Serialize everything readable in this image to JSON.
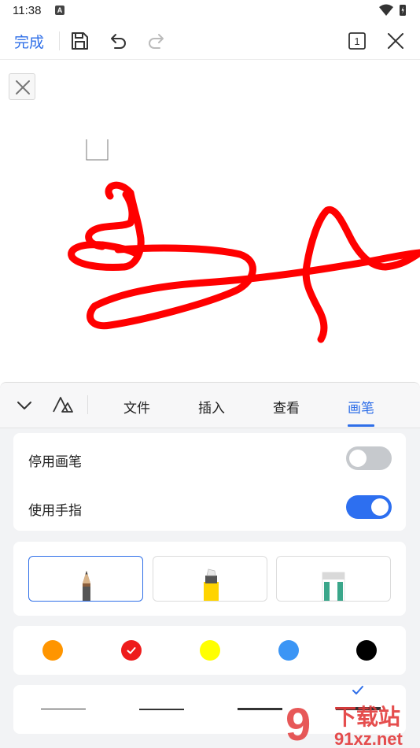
{
  "status_bar": {
    "time": "11:38"
  },
  "toolbar": {
    "done_label": "完成",
    "page_number": "1"
  },
  "tabs": [
    {
      "label": "文件"
    },
    {
      "label": "插入"
    },
    {
      "label": "查看"
    },
    {
      "label": "画笔",
      "active": true
    }
  ],
  "settings": {
    "disable_pen": {
      "label": "停用画笔",
      "on": false
    },
    "use_finger": {
      "label": "使用手指",
      "on": true
    }
  },
  "pen_tools": [
    {
      "name": "pencil",
      "selected": true
    },
    {
      "name": "highlighter",
      "selected": false
    },
    {
      "name": "eraser",
      "selected": false
    }
  ],
  "colors": [
    {
      "hex": "#ff9500",
      "selected": false
    },
    {
      "hex": "#ee1c1c",
      "selected": true
    },
    {
      "hex": "#ffff00",
      "selected": false
    },
    {
      "hex": "#3b95f5",
      "selected": false
    },
    {
      "hex": "#000000",
      "selected": false
    }
  ],
  "stroke_widths": [
    {
      "name": "thin",
      "selected": false
    },
    {
      "name": "medium",
      "selected": false
    },
    {
      "name": "thick",
      "selected": false
    },
    {
      "name": "extra-thick",
      "selected": true
    }
  ],
  "ink_color": "#ff0000",
  "accent_color": "#2f6fe8",
  "watermark": {
    "text": "下载站",
    "url": "91xz.net"
  }
}
